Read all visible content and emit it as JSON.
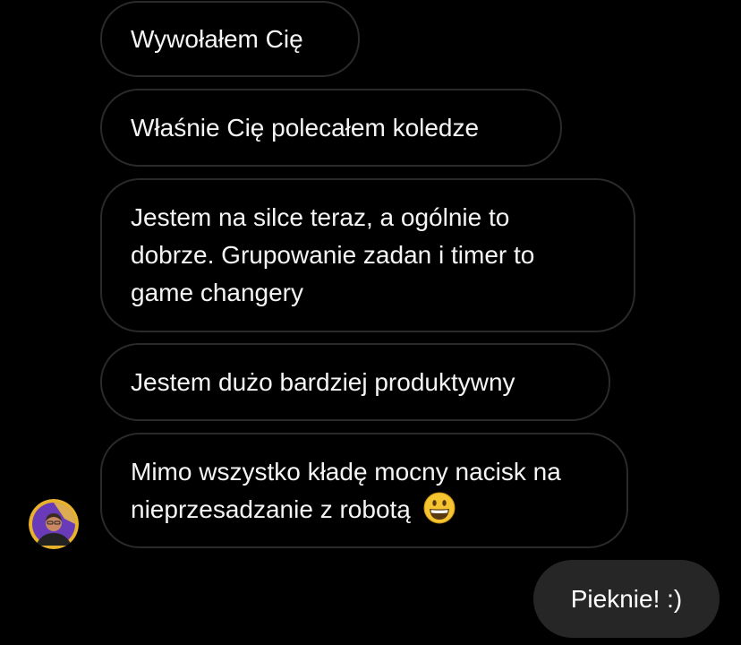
{
  "conversation": {
    "incoming": [
      {
        "text": "Wywołałem Cię"
      },
      {
        "text": "Właśnie Cię polecałem koledze"
      },
      {
        "text": "Jestem na silce teraz, a ogólnie to dobrze. Grupowanie zadan i timer to game changery"
      },
      {
        "text": "Jestem dużo bardziej produktywny"
      },
      {
        "text": "Mimo wszystko kładę mocny nacisk na nieprzesadzanie z robotą"
      }
    ],
    "outgoing": [
      {
        "text": "Pieknie! :)"
      }
    ],
    "last_incoming_emoji": "grinning-face-emoji",
    "avatar_icon": "user-avatar"
  },
  "colors": {
    "background": "#000000",
    "incoming_border": "#2a2a2a",
    "outgoing_bubble": "#262626",
    "emoji_yellow": "#f5c431",
    "avatar_ring": "#e8b22a",
    "avatar_bg": "#6a3bb8"
  }
}
